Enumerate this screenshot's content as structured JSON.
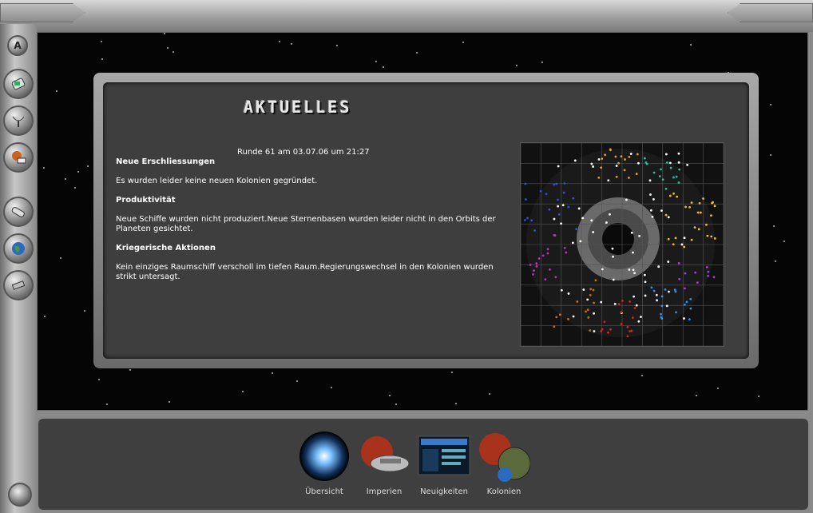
{
  "header": {
    "title": "AKTUELLES",
    "round_info": "Runde 61 am 03.07.06 um 21:27"
  },
  "sections": [
    {
      "heading": "Neue Erschliessungen",
      "text": "Es wurden leider keine neuen Kolonien gegründet."
    },
    {
      "heading": "Produktivität",
      "text": "Neue Schiffe wurden nicht produziert.Neue Sternenbasen wurden leider nicht in den Orbits der Planeten gesichtet."
    },
    {
      "heading": "Kriegerische Aktionen",
      "text": "Kein einziges Raumschiff verscholl im tiefen Raum.Regierungswechsel in den Kolonien wurden strikt untersagt."
    }
  ],
  "bottom_nav": [
    {
      "label": "Übersicht",
      "icon": "galaxy-icon"
    },
    {
      "label": "Imperien",
      "icon": "empire-ship-icon"
    },
    {
      "label": "Neuigkeiten",
      "icon": "news-screen-icon"
    },
    {
      "label": "Kolonien",
      "icon": "colony-planets-icon"
    }
  ],
  "sidebar": {
    "items": [
      "admin-icon",
      "handheld-icon",
      "satellite-dish-icon",
      "planet-book-icon",
      "phone-icon",
      "globe-icon",
      "ship-icon"
    ]
  },
  "colors": {
    "panel": "#3e3e3e",
    "space": "#050505",
    "frame": "#8a8a8a"
  }
}
